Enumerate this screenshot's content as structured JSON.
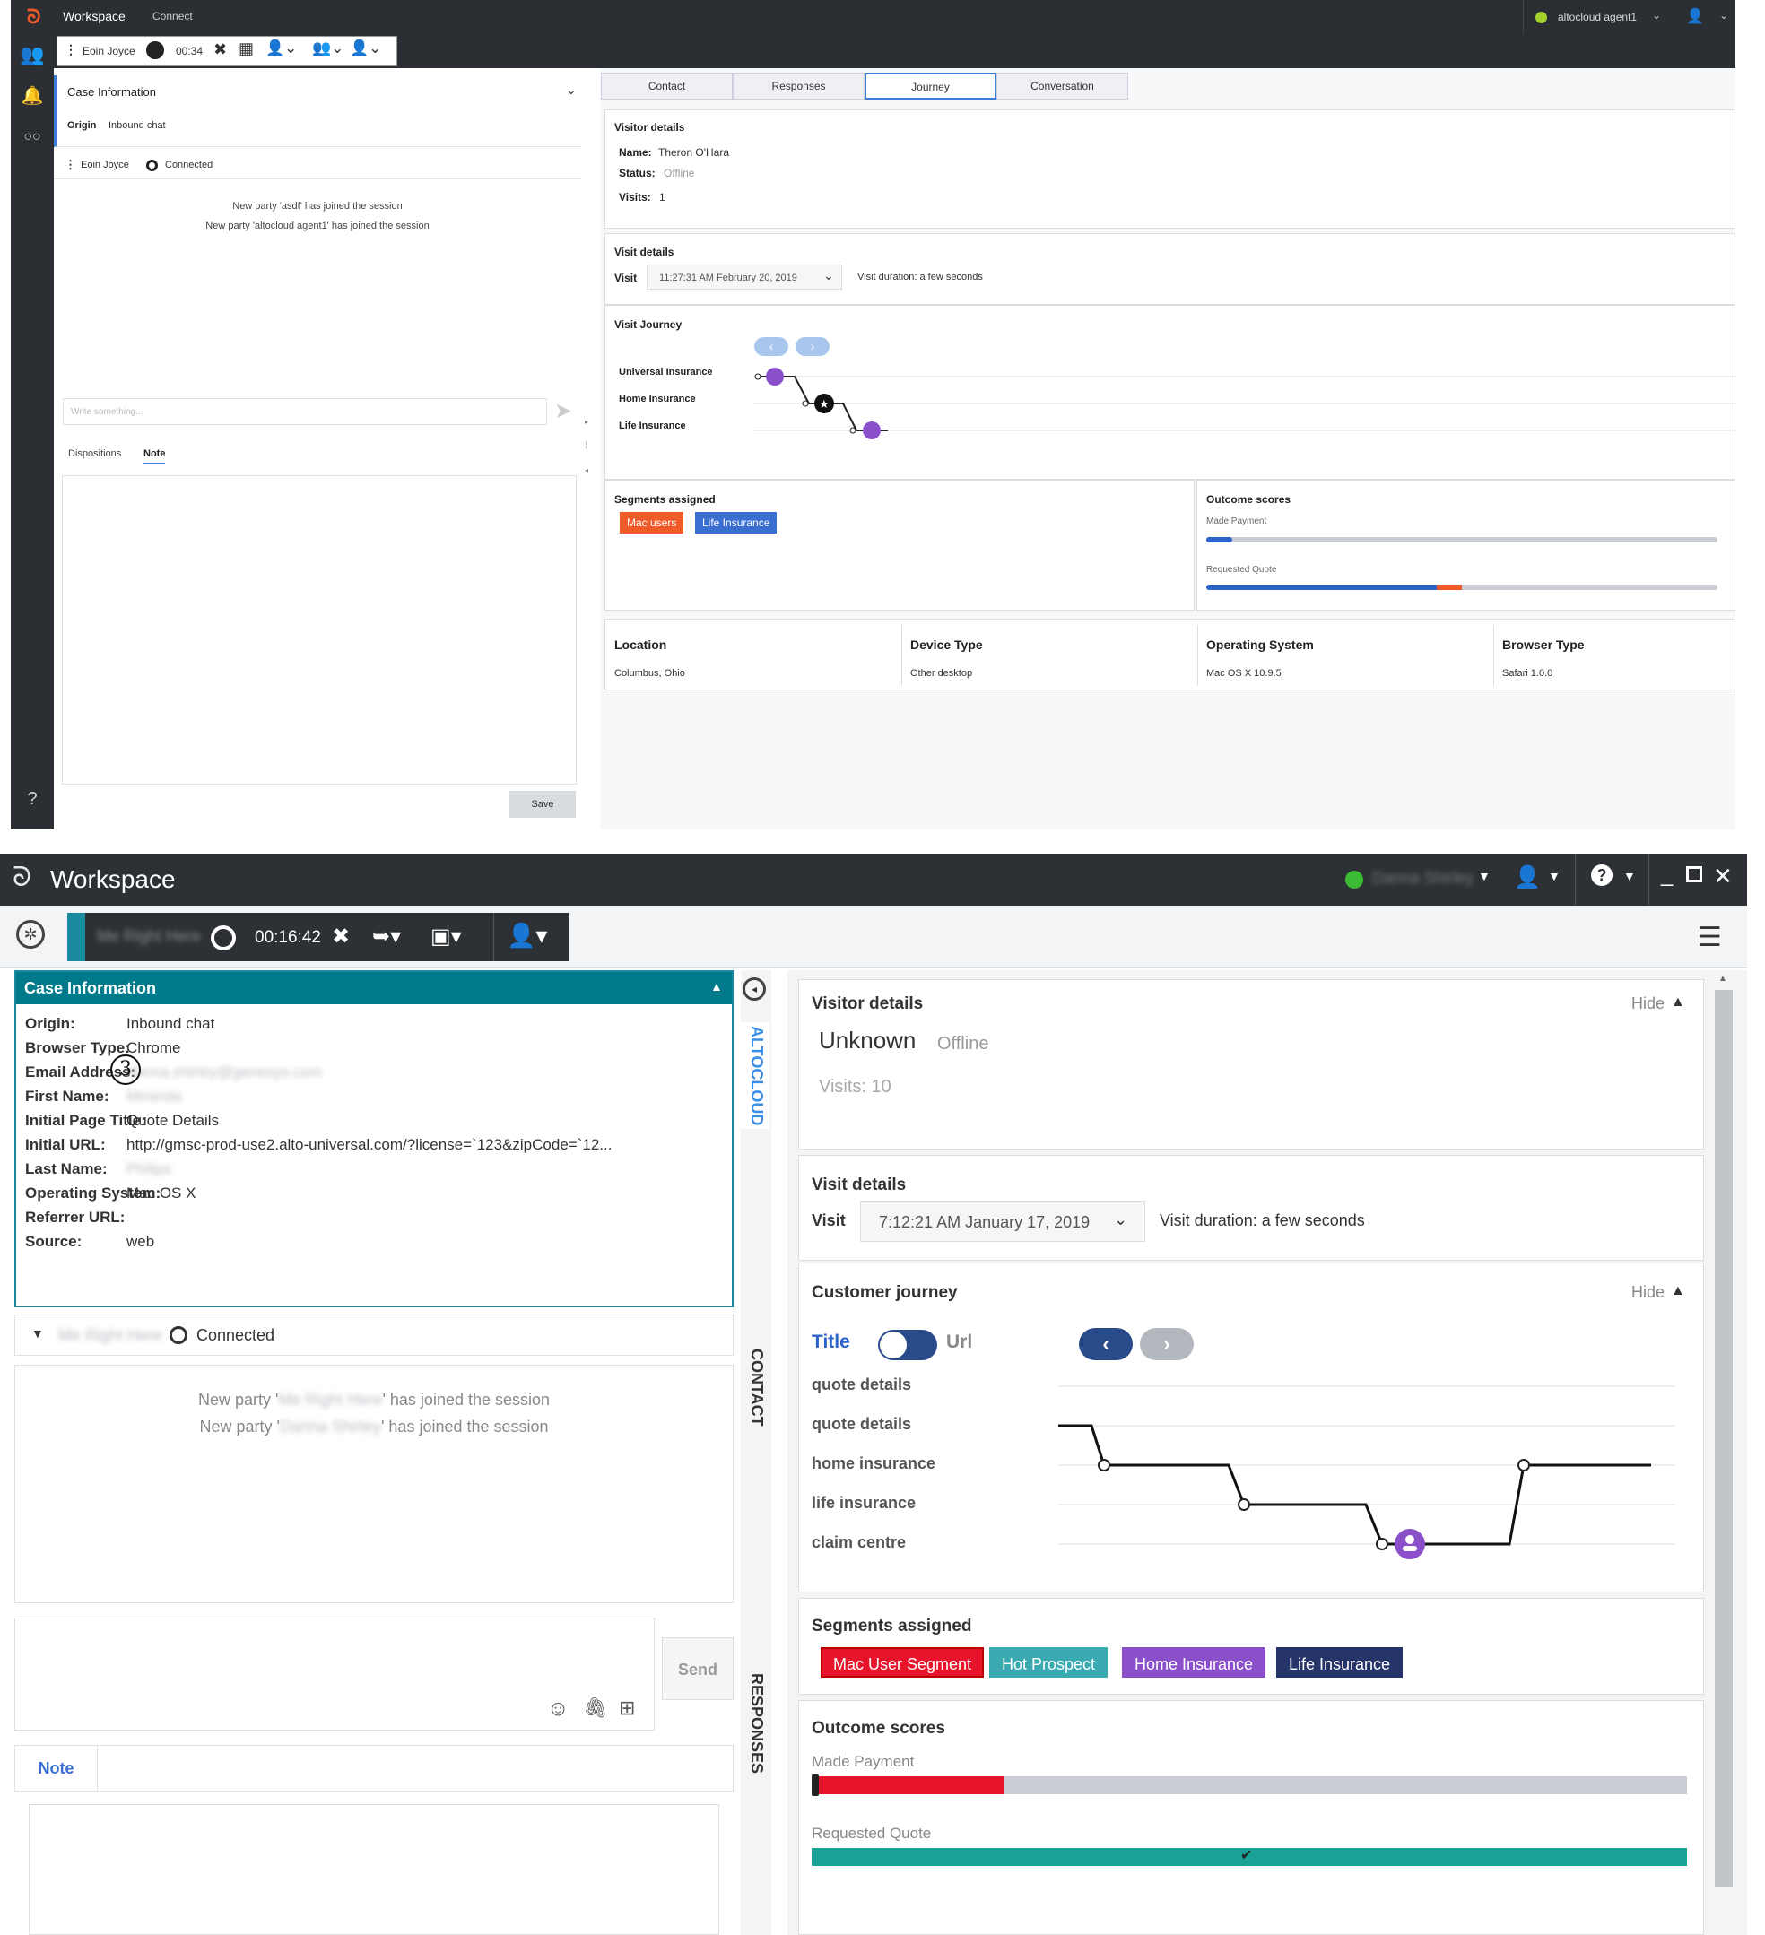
{
  "top": {
    "app_title": "Workspace",
    "app_nav": "Connect",
    "user": "altocloud agent1",
    "toolbar": {
      "participant": "Eoin Joyce",
      "timer": "00:34"
    },
    "case_info": {
      "title": "Case Information",
      "origin_label": "Origin",
      "origin_value": "Inbound chat"
    },
    "conversation": {
      "participant": "Eoin Joyce",
      "status": "Connected",
      "messages": [
        "New party 'asdf' has joined the session",
        "New party 'altocloud agent1' has joined the session"
      ],
      "input_placeholder": "Write something..."
    },
    "subtabs": [
      "Dispositions",
      "Note"
    ],
    "save_label": "Save",
    "help": "?",
    "tabs": [
      "Contact",
      "Responses",
      "Journey",
      "Conversation"
    ],
    "visitor": {
      "title": "Visitor details",
      "name_label": "Name:",
      "name": "Theron O'Hara",
      "status_label": "Status:",
      "status": "Offline",
      "visits_label": "Visits:",
      "visits": "1"
    },
    "visit": {
      "title": "Visit details",
      "label": "Visit",
      "selected": "11:27:31 AM February 20, 2019",
      "duration": "Visit duration: a few seconds"
    },
    "journey": {
      "title": "Visit Journey",
      "pages": [
        "Universal Insurance",
        "Home Insurance",
        "Life Insurance"
      ]
    },
    "segments": {
      "title": "Segments assigned",
      "items": [
        {
          "label": "Mac users",
          "color": "#f05a28"
        },
        {
          "label": "Life Insurance",
          "color": "#3a6fd1"
        }
      ]
    },
    "outcomes": {
      "title": "Outcome scores",
      "items": [
        {
          "label": "Made Payment",
          "value": 0.05
        },
        {
          "label": "Requested Quote",
          "value": 0.5
        }
      ]
    },
    "info": [
      {
        "label": "Location",
        "value": "Columbus, Ohio"
      },
      {
        "label": "Device Type",
        "value": "Other desktop"
      },
      {
        "label": "Operating System",
        "value": "Mac OS X 10.9.5"
      },
      {
        "label": "Browser Type",
        "value": "Safari 1.0.0"
      }
    ]
  },
  "bottom": {
    "app_title": "Workspace",
    "timer": "00:16:42",
    "case_info": {
      "title": "Case Information",
      "rows": [
        {
          "label": "Origin:",
          "value": "Inbound chat"
        },
        {
          "label": "Browser Type:",
          "value": "Chrome"
        },
        {
          "label": "Email Address:",
          "value": "danna.shirley@genesys.com"
        },
        {
          "label": "First Name:",
          "value": "Miranda"
        },
        {
          "label": "Initial Page Title:",
          "value": "Quote Details"
        },
        {
          "label": "Initial URL:",
          "value": "http://gmsc-prod-use2.alto-universal.com/?license=`123&zipCode=`12..."
        },
        {
          "label": "Last Name:",
          "value": "Philips"
        },
        {
          "label": "Operating System:",
          "value": "Mac OS X"
        },
        {
          "label": "Referrer URL:",
          "value": ""
        },
        {
          "label": "Source:",
          "value": "web"
        }
      ],
      "callout": "3"
    },
    "conversation": {
      "status": "Connected",
      "msg_prefix": "New party '",
      "msg_suffix": "' has joined the session"
    },
    "send_label": "Send",
    "note_tab": "Note",
    "side_tabs": [
      "ALTOCLOUD",
      "CONTACT",
      "RESPONSES"
    ],
    "visitor": {
      "title": "Visitor details",
      "hide": "Hide",
      "name": "Unknown",
      "status": "Offline",
      "visits": "Visits: 10"
    },
    "visit": {
      "title": "Visit details",
      "label": "Visit",
      "selected": "7:12:21 AM January 17, 2019",
      "duration": "Visit duration: a few seconds"
    },
    "journey": {
      "title": "Customer journey",
      "hide": "Hide",
      "toggle_left": "Title",
      "toggle_right": "Url",
      "pages": [
        "quote details",
        "quote details",
        "home insurance",
        "life insurance",
        "claim centre"
      ]
    },
    "segments": {
      "title": "Segments assigned",
      "items": [
        {
          "label": "Mac User Segment",
          "color": "#e8142b"
        },
        {
          "label": "Hot Prospect",
          "color": "#3aa9b0"
        },
        {
          "label": "Home Insurance",
          "color": "#8a4fc9"
        },
        {
          "label": "Life Insurance",
          "color": "#25356a"
        }
      ]
    },
    "outcomes": {
      "title": "Outcome scores",
      "items": [
        {
          "label": "Made Payment",
          "value": 0.22
        },
        {
          "label": "Requested Quote",
          "value": 1.0
        }
      ]
    },
    "colors": {
      "accent": "#007a8a",
      "teal": "#1aa196",
      "purple": "#8a4fc9"
    }
  }
}
